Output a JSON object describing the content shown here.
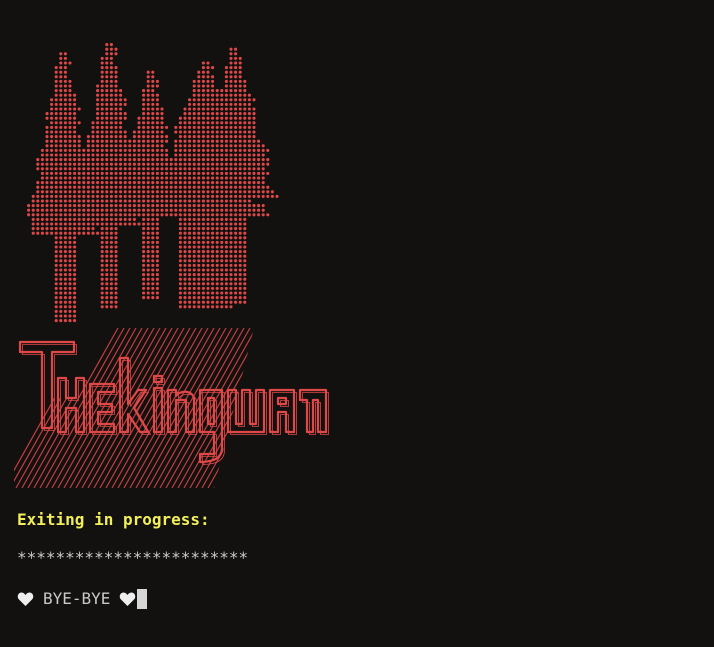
{
  "terminal": {
    "status": "Exiting in progress:",
    "progress": "************************",
    "bye_text": "BYE-BYE",
    "heart_icon": "heart-icon",
    "banner_logo_text": "Thekingwan"
  },
  "colors": {
    "background": "#121110",
    "art": "#e04848",
    "status": "#f2ef5a",
    "text": "#c9c9c9",
    "cursor": "#d6d6d6"
  }
}
